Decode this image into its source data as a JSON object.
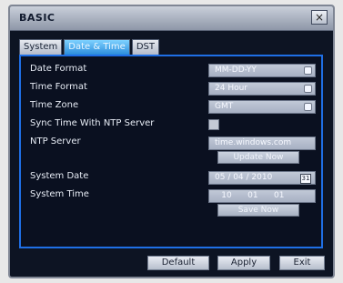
{
  "window": {
    "title": "BASIC",
    "close_glyph": "×",
    "tabs": [
      {
        "label": "System",
        "active": false
      },
      {
        "label": "Date & Time",
        "active": true
      },
      {
        "label": "DST",
        "active": false
      }
    ]
  },
  "form": {
    "date_format": {
      "label": "Date Format",
      "value": "MM-DD-YY"
    },
    "time_format": {
      "label": "Time Format",
      "value": "24 Hour"
    },
    "time_zone": {
      "label": "Time Zone",
      "value": "GMT"
    },
    "sync_ntp": {
      "label": "Sync Time With NTP Server",
      "checked": false
    },
    "ntp_server": {
      "label": "NTP Server",
      "value": "time.windows.com"
    },
    "update_now_label": "Update Now",
    "system_date": {
      "label": "System Date",
      "value": "05 / 04 / 2010",
      "calendar_glyph": "31"
    },
    "system_time": {
      "label": "System Time",
      "hour": "10",
      "minute": "01",
      "second": "01"
    },
    "save_now_label": "Save Now"
  },
  "footer": {
    "default_label": "Default",
    "apply_label": "Apply",
    "exit_label": "Exit"
  },
  "colors": {
    "panel_border": "#1f6fe6",
    "background": "#0a1020",
    "tab_active": "#2c8ddc"
  },
  "icons": [
    "close-icon",
    "dropdown-arrow-icon",
    "calendar-icon",
    "checkbox-icon"
  ]
}
